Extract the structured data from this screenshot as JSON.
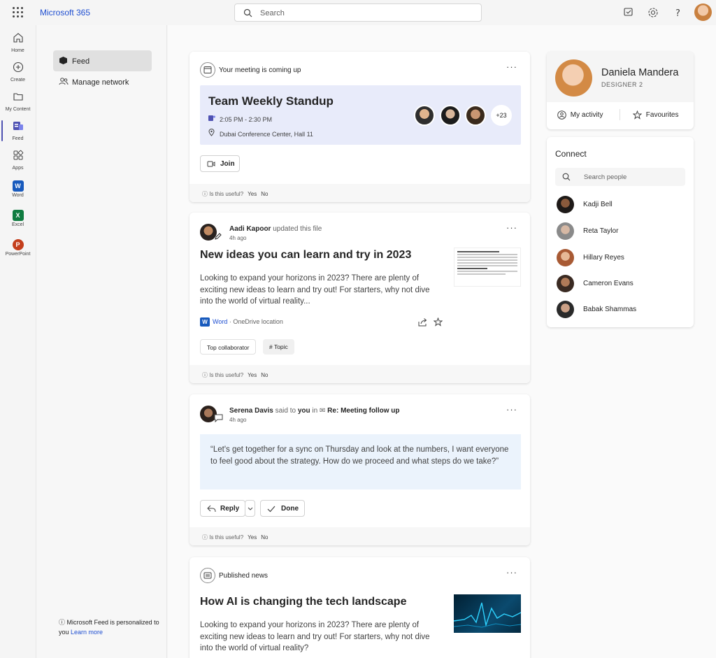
{
  "app": {
    "title": "Microsoft 365"
  },
  "search": {
    "placeholder": "Search"
  },
  "top_icons": [
    "feedback-icon",
    "gear-icon",
    "help-icon",
    "avatar"
  ],
  "rail": [
    {
      "label": "Home",
      "icon": "home-icon"
    },
    {
      "label": "Create",
      "icon": "create-icon"
    },
    {
      "label": "My Content",
      "icon": "folder-icon"
    },
    {
      "label": "Feed",
      "icon": "feed-icon",
      "active": true
    },
    {
      "label": "Apps",
      "icon": "apps-icon"
    },
    {
      "label": "Word",
      "icon": "word-icon"
    },
    {
      "label": "Excel",
      "icon": "excel-icon"
    },
    {
      "label": "PowerPoint",
      "icon": "powerpoint-icon"
    }
  ],
  "subnav": {
    "items": [
      {
        "label": "Feed",
        "selected": true
      },
      {
        "label": "Manage network"
      }
    ],
    "footer": {
      "text": "Microsoft Feed is personalized to you",
      "link": "Learn more"
    }
  },
  "useful": {
    "question": "Is this useful?",
    "yes": "Yes",
    "no": "No"
  },
  "meeting_card": {
    "header": "Your meeting is coming up",
    "title": "Team Weekly Standup",
    "time": "2:05 PM - 2:30 PM",
    "location": "Dubai Conference Center, Hall 11",
    "more_attendees": "+23",
    "join": "Join"
  },
  "file_card": {
    "author": "Aadi Kapoor",
    "action": "updated this file",
    "time": "4h ago",
    "title": "New ideas you can learn and try in 2023",
    "body": "Looking to expand your horizons in 2023? There are plenty of exciting new ideas to learn and try out! For starters, why not dive into the world of virtual reality...",
    "app": "Word",
    "location": "OneDrive location",
    "chips": [
      "Top collaborator",
      "Topic"
    ]
  },
  "message_card": {
    "author": "Serena Davis",
    "action": "said to",
    "target": "you",
    "preposition": "in",
    "subject": "Re: Meeting follow up",
    "time": "4h ago",
    "quote": "“Let's get together for a sync on Thursday and look at the numbers, I want everyone to feel good about the strategy. How do we proceed and what steps do we take?”",
    "reply": "Reply",
    "done": "Done"
  },
  "news_card": {
    "header": "Published news",
    "title": "How AI is changing the tech landscape",
    "body": "Looking to expand your horizons in 2023? There are plenty of exciting new ideas to learn and try out! For starters, why not dive into the world of virtual reality?"
  },
  "profile": {
    "name": "Daniela Mandera",
    "role": "DESIGNER 2",
    "activity": "My activity",
    "favourites": "Favourites"
  },
  "connect": {
    "title": "Connect",
    "search_placeholder": "Search people",
    "people": [
      "Kadji Bell",
      "Reta Taylor",
      "Hillary Reyes",
      "Cameron Evans",
      "Babak Shammas"
    ]
  },
  "colors": {
    "accent": "#1f4fd1",
    "brand_purple": "#4f52b2",
    "meeting_bg": "#e8ebfa",
    "quote_bg": "#ebf3fc"
  }
}
